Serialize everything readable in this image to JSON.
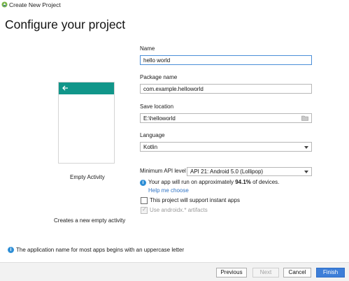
{
  "window": {
    "title": "Create New Project",
    "icon": "android-studio-icon"
  },
  "page": {
    "heading": "Configure your project"
  },
  "template_preview": {
    "activity_name": "Empty Activity",
    "description": "Creates a new empty activity",
    "accent_color": "#11968a"
  },
  "form": {
    "name": {
      "label": "Name",
      "value": "hello world"
    },
    "package": {
      "label": "Package name",
      "value": "com.example.helloworld"
    },
    "save_location": {
      "label": "Save location",
      "value": "E:\\helloworld"
    },
    "language": {
      "label": "Language",
      "value": "Kotlin"
    },
    "min_api": {
      "label": "Minimum API level",
      "value": "API 21: Android 5.0 (Lollipop)"
    },
    "api_info": {
      "prefix": "Your app will run on approximately ",
      "percent": "94.1%",
      "suffix": " of devices."
    },
    "help_link": "Help me choose",
    "instant_apps": {
      "label": "This project will support instant apps",
      "checked": false
    },
    "androidx": {
      "label": "Use androidx.* artifacts",
      "checked": true,
      "enabled": false
    }
  },
  "status_message": "The application name for most apps begins with an uppercase letter",
  "buttons": {
    "previous": "Previous",
    "next": "Next",
    "cancel": "Cancel",
    "finish": "Finish"
  },
  "colors": {
    "primary_button": "#3d7ed8",
    "link": "#2f73c4",
    "info": "#2f8fd6",
    "focus_border": "#4b8fd8"
  }
}
